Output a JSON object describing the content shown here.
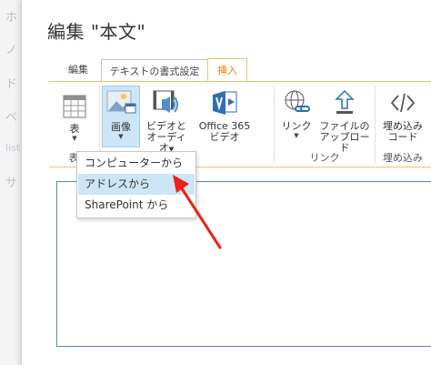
{
  "background_nav": {
    "items": [
      "ホ",
      "ノ",
      "ド",
      "ペ",
      "list",
      "サ"
    ]
  },
  "dialog": {
    "title": "編集 \"本文\""
  },
  "tabs": [
    {
      "label": "編集"
    },
    {
      "label": "テキストの書式設定"
    },
    {
      "label": "挿入",
      "active": true
    }
  ],
  "ribbon": {
    "groups": [
      {
        "label": "表",
        "buttons": [
          {
            "label": "表"
          }
        ]
      },
      {
        "label": "",
        "buttons": [
          {
            "label": "画像",
            "selected": true
          },
          {
            "label1": "ビデオと",
            "label2": "オーディオ"
          },
          {
            "label1": "Office 365",
            "label2": "ビデオ"
          }
        ]
      },
      {
        "label": "リンク",
        "buttons": [
          {
            "label": "リンク"
          },
          {
            "label1": "ファイルの",
            "label2": "アップロード"
          }
        ]
      },
      {
        "label": "埋め込み",
        "buttons": [
          {
            "label1": "埋め込み",
            "label2": "コード"
          }
        ]
      }
    ]
  },
  "image_dropdown": {
    "items": [
      {
        "label": "コンピューターから"
      },
      {
        "label": "アドレスから",
        "hover": true
      },
      {
        "label": "SharePoint から"
      }
    ]
  },
  "colors": {
    "accent_orange": "#f08000",
    "selection_blue": "#cde6f7",
    "editor_border": "#5a86bd",
    "annotation_arrow": "#e8211a"
  }
}
